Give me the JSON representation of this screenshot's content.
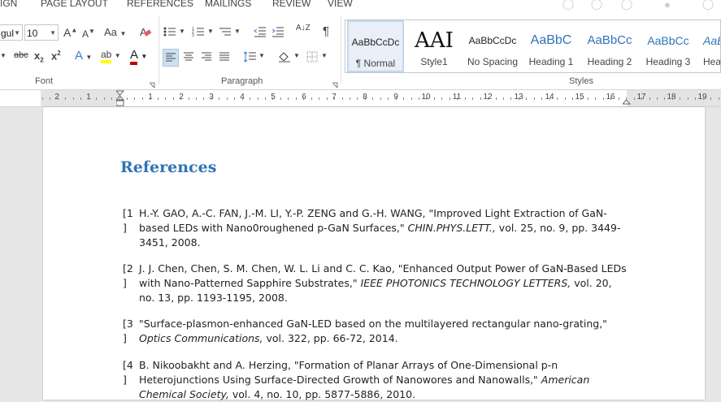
{
  "ribbon_tabs": [
    "IGN",
    "PAGE LAYOUT",
    "REFERENCES",
    "MAILINGS",
    "REVIEW",
    "VIEW"
  ],
  "font": {
    "name_value": "gul",
    "size_value": "10",
    "grow_label": "A",
    "shrink_label": "A",
    "case_label": "Aa",
    "strike_label": "abc",
    "subscript_label": "x",
    "subscript_mark": "2",
    "superscript_label": "x",
    "superscript_mark": "2",
    "effects_label": "A",
    "highlight_label": "ab",
    "font_color_label": "A",
    "group_label": "Font"
  },
  "paragraph": {
    "pilcrow": "¶",
    "sort_label": "A↓Z",
    "group_label": "Paragraph"
  },
  "styles": {
    "group_label": "Styles",
    "items": [
      {
        "preview": "AaBbCcDc",
        "name": "¶ Normal",
        "selected": true
      },
      {
        "preview": "AAI",
        "name": "Style1",
        "selected": false
      },
      {
        "preview": "AaBbCcDc",
        "name": "No Spacing",
        "selected": false
      },
      {
        "preview": "AaBbC",
        "name": "Heading 1",
        "selected": false
      },
      {
        "preview": "AaBbCc",
        "name": "Heading 2",
        "selected": false
      },
      {
        "preview": "AaBbCc",
        "name": "Heading 3",
        "selected": false
      },
      {
        "preview": "AaBl",
        "name": "Hea",
        "selected": false
      }
    ]
  },
  "ruler": {
    "labels": [
      "2",
      "1",
      "1",
      "2",
      "3",
      "4",
      "5",
      "6",
      "7",
      "8",
      "9",
      "10",
      "11",
      "12",
      "13",
      "14",
      "15",
      "16",
      "17",
      "18",
      "19"
    ]
  },
  "document": {
    "heading": "References",
    "references": [
      {
        "label_top": "[1",
        "label_bottom": "]",
        "pre": "H.-Y. GAO, A.-C. FAN, J.-M. LI, Y.-P. ZENG and G.-H. WANG, \"Improved Light Extraction of GaN-based LEDs with Nano0roughened p-GaN Surfaces,\" ",
        "journal": "CHIN.PHYS.LETT.,",
        "post": " vol. 25, no. 9, pp. 3449-3451, 2008."
      },
      {
        "label_top": "[2",
        "label_bottom": "]",
        "pre": "J. J. Chen, Chen, S. M. Chen, W. L. Li and C. C. Kao, \"Enhanced Output Power of GaN-Based LEDs with Nano-Patterned Sapphire Substrates,\" ",
        "journal": "IEEE PHOTONICS TECHNOLOGY LETTERS,",
        "post": " vol. 20, no. 13, pp. 1193-1195, 2008."
      },
      {
        "label_top": "[3",
        "label_bottom": "]",
        "pre": "\"Surface-plasmon-enhanced GaN-LED based on the multilayered rectangular nano-grating,\" ",
        "journal": "Optics Communications,",
        "post": " vol. 322, pp. 66-72, 2014."
      },
      {
        "label_top": "[4",
        "label_bottom": "]",
        "pre": "B. Nikoobakht and A. Herzing, \"Formation of Planar Arrays of One-Dimensional p-n Heterojunctions Using Surface-Directed Growth of Nanowores and Nanowalls,\" ",
        "journal": "American Chemical Society,",
        "post": " vol. 4, no. 10, pp. 5877-5886, 2010."
      }
    ]
  },
  "colors": {
    "heading_blue": "#2e74b5",
    "highlight_yellow": "#ffff00",
    "font_color_red": "#c00000",
    "selected_style_bg": "#e8eff7"
  }
}
